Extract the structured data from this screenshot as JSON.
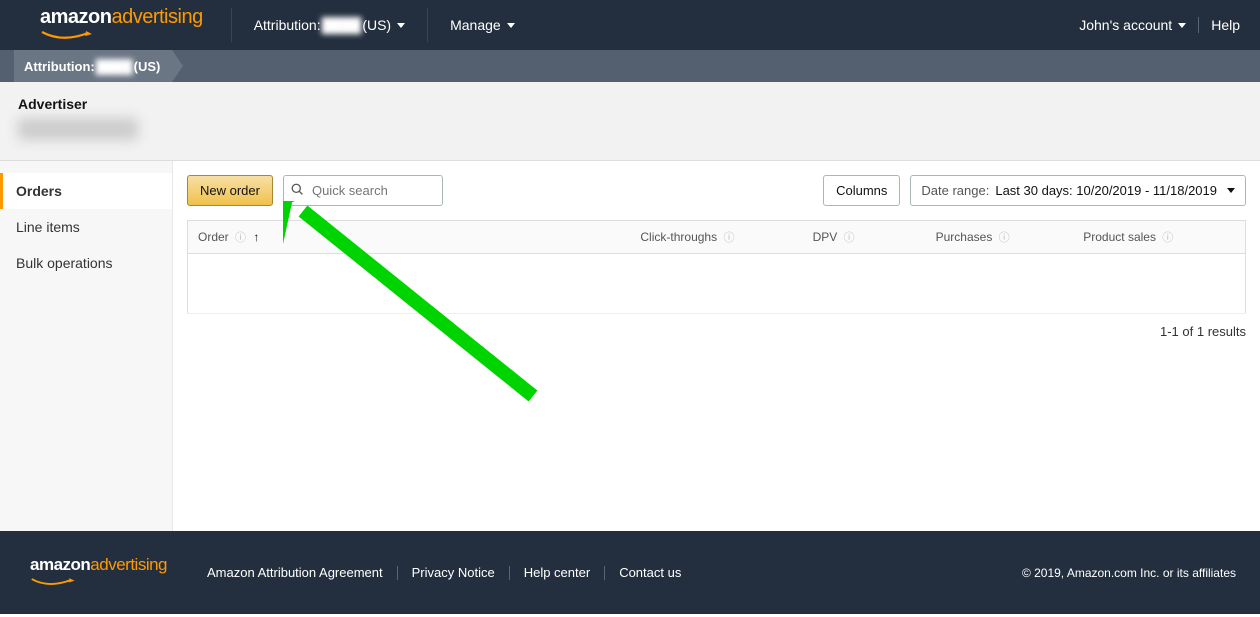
{
  "brand": {
    "amazon": "amazon",
    "advertising": "advertising"
  },
  "topnav": {
    "attribution_prefix": "Attribution:",
    "attribution_suffix": "(US)",
    "manage": "Manage",
    "account": "John's account",
    "help": "Help"
  },
  "breadcrumb": {
    "prefix": "Attribution:",
    "suffix": "(US)"
  },
  "advertiser": {
    "label": "Advertiser"
  },
  "sidebar": {
    "items": [
      {
        "label": "Orders",
        "active": true
      },
      {
        "label": "Line items",
        "active": false
      },
      {
        "label": "Bulk operations",
        "active": false
      }
    ]
  },
  "toolbar": {
    "new_order": "New order",
    "search_placeholder": "Quick search",
    "columns": "Columns",
    "date_range_label": "Date range:",
    "date_range_value": "Last 30 days: 10/20/2019 - 11/18/2019"
  },
  "table": {
    "columns": [
      {
        "label": "Order",
        "info": true,
        "sort": "asc"
      },
      {
        "label": "Click-throughs",
        "info": true
      },
      {
        "label": "DPV",
        "info": true
      },
      {
        "label": "Purchases",
        "info": true
      },
      {
        "label": "Product sales",
        "info": true
      }
    ],
    "results": "1-1 of 1 results"
  },
  "footer": {
    "links": [
      "Amazon Attribution Agreement",
      "Privacy Notice",
      "Help center",
      "Contact us"
    ],
    "copyright": "© 2019, Amazon.com Inc. or its affiliates"
  }
}
